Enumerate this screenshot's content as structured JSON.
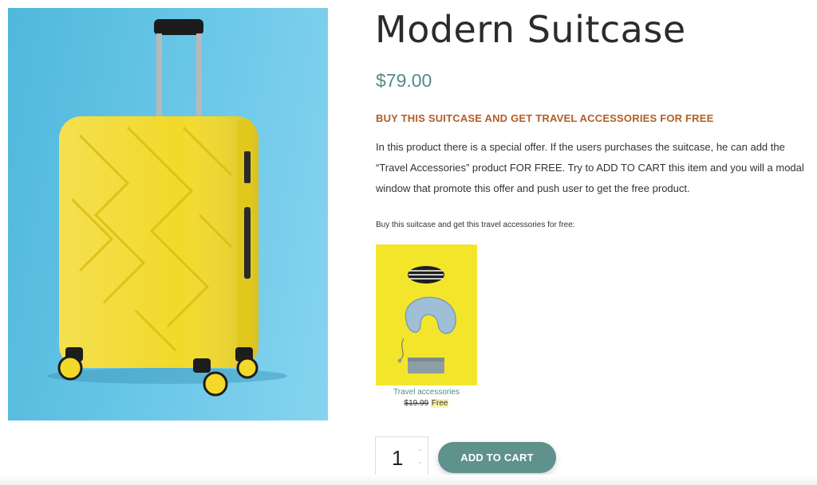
{
  "product": {
    "title": "Modern Suitcase",
    "price": "$79.00",
    "offer_heading": "BUY THIS SUITCASE AND GET TRAVEL ACCESSORIES FOR FREE",
    "description": "In this product there is a special offer. If the users purchases the suitcase, he can add the “Travel Accessories” product FOR FREE. Try to ADD TO CART this item and you will a modal window that promote this offer and push user to get the free product."
  },
  "bundle": {
    "label": "Buy this suitcase and get this travel accessories for free:",
    "item_name": "Travel accessories",
    "old_price": "$19.99",
    "new_price": "Free"
  },
  "cart": {
    "quantity": "1",
    "add_to_cart_label": "ADD TO CART",
    "qty_up_icon": "chevron-up-icon",
    "qty_down_icon": "chevron-down-icon"
  },
  "colors": {
    "accent": "#5f918d",
    "offer": "#b55d27",
    "suitcase": "#f2d92a",
    "background_photo": "#5cbfe2"
  }
}
